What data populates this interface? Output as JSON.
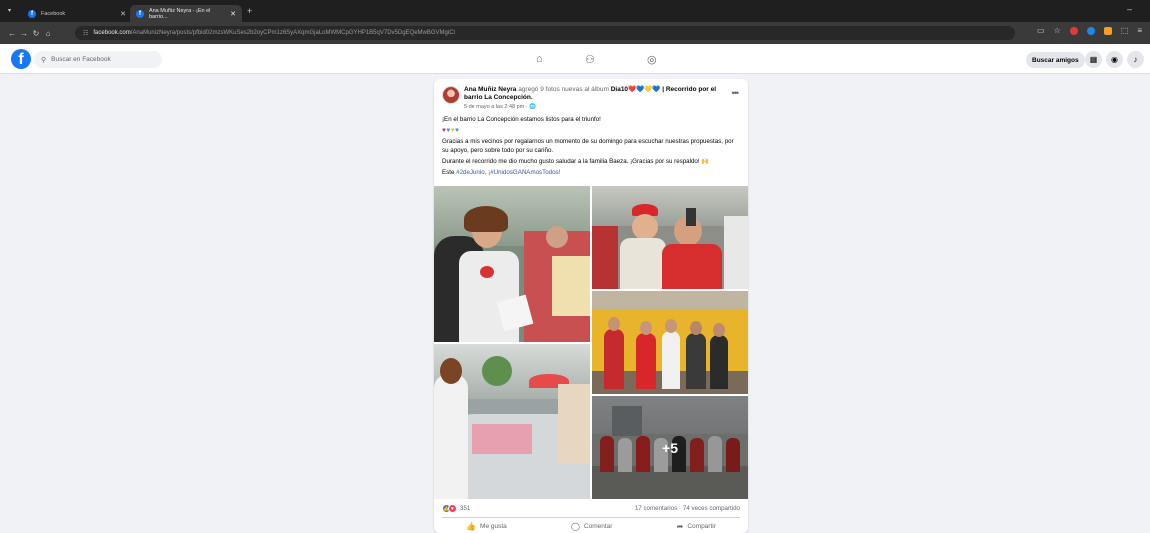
{
  "browser": {
    "tabs": [
      {
        "title": "Facebook"
      },
      {
        "title": "Ana Muñiz Neyra - ¡En el barrio..."
      }
    ],
    "url_host": "facebook.com",
    "url_path": "/AnaMunizNeyra/posts/pfbid02mzsWKuSes2b2oyCPm1z6SyAXqmGjaLoMWMCpGYHP1B5qV7Dv5DgEQeMwBGVMgiCl"
  },
  "facebook": {
    "search_placeholder": "Buscar en Facebook",
    "find_friends_label": "Buscar amigos"
  },
  "post": {
    "author": "Ana Muñiz Neyra",
    "action_text": "agregó 9 fotos nuevas al álbum",
    "album_title": "Dia10❤️💙💛💙 | Recorrido por el barrio La Concepción.",
    "timestamp": "5 de mayo a las 2:48 pm · 🌐",
    "line1": "¡En el barrio La Concepción estamos listos para el triunfo!",
    "line2": "Gracias a mis vecinos por regalarnos un momento de su domingo para escuchar nuestras propuestas, por su apoyo, pero sobre todo por su cariño.",
    "line3": "Durante el recorrido me dio mucho gusto saludar a la familia Baeza. ¡Gracias por su respaldo! 🙌",
    "line4_prefix": "Este",
    "hashtag1": "#2deJunio,",
    "hashtag2": "¡#UnidosGANAmosTodos!",
    "more_photos": "+5",
    "reaction_count": "351",
    "comments": "17 comentarios",
    "shares": "74 veces compartido",
    "like_label": "Me gusta",
    "comment_label": "Comentar",
    "share_label": "Compartir"
  }
}
